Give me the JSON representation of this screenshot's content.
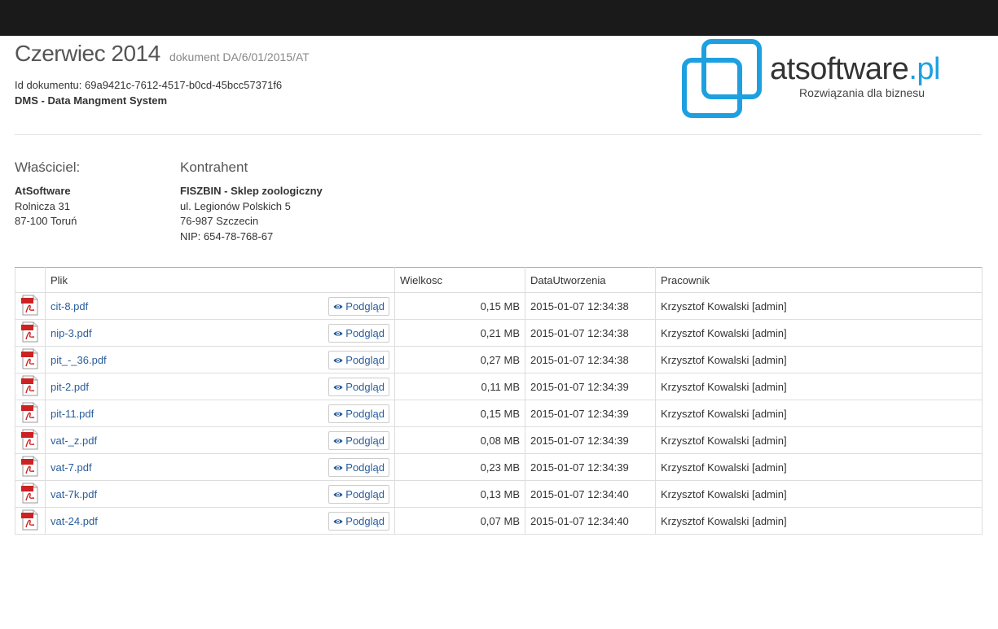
{
  "header": {
    "title": "Czerwiec 2014",
    "subtitle": "dokument DA/6/01/2015/AT",
    "doc_id": "Id dokumentu: 69a9421c-7612-4517-b0cd-45bcc57371f6",
    "system": "DMS - Data Mangment System"
  },
  "logo": {
    "name": "atsoftware",
    "tld": ".pl",
    "tagline": "Rozwiązania dla biznesu",
    "accent": "#1ea0e0"
  },
  "owner": {
    "heading": "Właściciel:",
    "name": "AtSoftware",
    "street": "Rolnicza 31",
    "city": "87-100 Toruń"
  },
  "contractor": {
    "heading": "Kontrahent",
    "name": "FISZBIN - Sklep zoologiczny",
    "street": "ul. Legionów Polskich 5",
    "city": "76-987 Szczecin",
    "nip": "NIP: 654-78-768-67"
  },
  "table": {
    "columns": [
      "",
      "Plik",
      "Wielkosc",
      "DataUtworzenia",
      "Pracownik"
    ],
    "view_label": "Podgląd",
    "file_icon": "pdf-icon",
    "rows": [
      {
        "file": "cit-8.pdf",
        "size": "0,15 MB",
        "date": "2015-01-07 12:34:38",
        "worker": "Krzysztof Kowalski [admin]"
      },
      {
        "file": "nip-3.pdf",
        "size": "0,21 MB",
        "date": "2015-01-07 12:34:38",
        "worker": "Krzysztof Kowalski [admin]"
      },
      {
        "file": "pit_-_36.pdf",
        "size": "0,27 MB",
        "date": "2015-01-07 12:34:38",
        "worker": "Krzysztof Kowalski [admin]"
      },
      {
        "file": "pit-2.pdf",
        "size": "0,11 MB",
        "date": "2015-01-07 12:34:39",
        "worker": "Krzysztof Kowalski [admin]"
      },
      {
        "file": "pit-11.pdf",
        "size": "0,15 MB",
        "date": "2015-01-07 12:34:39",
        "worker": "Krzysztof Kowalski [admin]"
      },
      {
        "file": "vat-_z.pdf",
        "size": "0,08 MB",
        "date": "2015-01-07 12:34:39",
        "worker": "Krzysztof Kowalski [admin]"
      },
      {
        "file": "vat-7.pdf",
        "size": "0,23 MB",
        "date": "2015-01-07 12:34:39",
        "worker": "Krzysztof Kowalski [admin]"
      },
      {
        "file": "vat-7k.pdf",
        "size": "0,13 MB",
        "date": "2015-01-07 12:34:40",
        "worker": "Krzysztof Kowalski [admin]"
      },
      {
        "file": "vat-24.pdf",
        "size": "0,07 MB",
        "date": "2015-01-07 12:34:40",
        "worker": "Krzysztof Kowalski [admin]"
      }
    ]
  }
}
